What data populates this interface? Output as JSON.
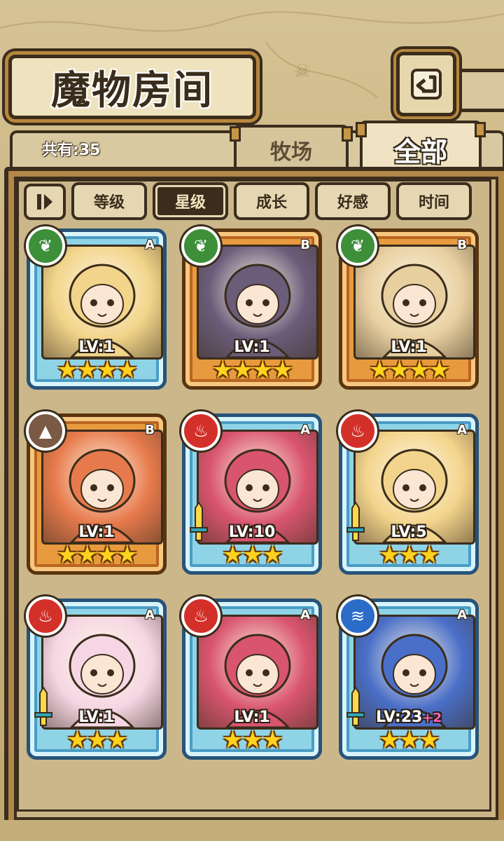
{
  "title": "魔物房间",
  "back_icon": "back-arrow-icon",
  "count_text": "共有:35",
  "tabs": [
    {
      "label": "牧场",
      "active": false
    },
    {
      "label": "全部",
      "active": true
    }
  ],
  "filters": [
    {
      "label": "等级",
      "active": false
    },
    {
      "label": "星级",
      "active": true
    },
    {
      "label": "成长",
      "active": false
    },
    {
      "label": "好感",
      "active": false
    },
    {
      "label": "时间",
      "active": false
    }
  ],
  "cards": [
    {
      "level_text": "LV:1",
      "plus": "",
      "stars": 4,
      "stars_text": "★★★★",
      "rank": "A",
      "element": "grass",
      "portrait_color": "#f2d48a",
      "weapon": false
    },
    {
      "level_text": "LV:1",
      "plus": "",
      "stars": 4,
      "stars_text": "★★★★",
      "rank": "B",
      "element": "grass",
      "portrait_color": "#6b5c7a",
      "weapon": false
    },
    {
      "level_text": "LV:1",
      "plus": "",
      "stars": 4,
      "stars_text": "★★★★",
      "rank": "B",
      "element": "grass",
      "portrait_color": "#e8cfa0",
      "weapon": false
    },
    {
      "level_text": "LV:1",
      "plus": "",
      "stars": 4,
      "stars_text": "★★★★",
      "rank": "B",
      "element": "earth",
      "portrait_color": "#e77a4c",
      "weapon": false
    },
    {
      "level_text": "LV:10",
      "plus": "",
      "stars": 3,
      "stars_text": "★★★",
      "rank": "A",
      "element": "fire",
      "portrait_color": "#d9556f",
      "weapon": true
    },
    {
      "level_text": "LV:5",
      "plus": "",
      "stars": 3,
      "stars_text": "★★★",
      "rank": "A",
      "element": "fire",
      "portrait_color": "#f3d48c",
      "weapon": true
    },
    {
      "level_text": "LV:1",
      "plus": "",
      "stars": 3,
      "stars_text": "★★★",
      "rank": "A",
      "element": "fire",
      "portrait_color": "#f6d6e4",
      "weapon": true
    },
    {
      "level_text": "LV:1",
      "plus": "",
      "stars": 3,
      "stars_text": "★★★",
      "rank": "A",
      "element": "fire",
      "portrait_color": "#d9556f",
      "weapon": false
    },
    {
      "level_text": "LV:23",
      "plus": "+2",
      "stars": 3,
      "stars_text": "★★★",
      "rank": "A",
      "element": "water",
      "portrait_color": "#4a6fc8",
      "weapon": true
    }
  ]
}
